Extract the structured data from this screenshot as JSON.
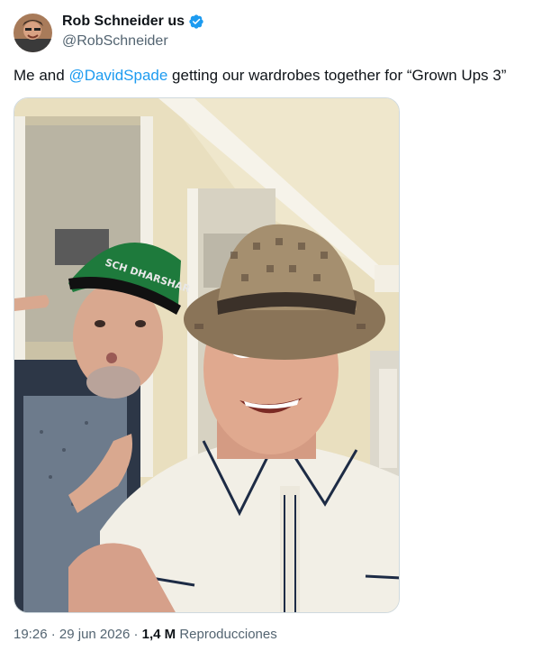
{
  "author": {
    "display_name": "Rob Schneider us",
    "handle": "@RobSchneider",
    "avatar_icon": "profile-photo",
    "verified_icon": "verified-badge-icon",
    "verified_color": "#1d9bf0"
  },
  "tweet": {
    "text_prefix": "Me and ",
    "mention": "@DavidSpade",
    "text_suffix": " getting our wardrobes together for “Grown Ups 3”",
    "mention_color": "#1d9bf0"
  },
  "media": {
    "hat_text": "SCH DHARSHAR"
  },
  "meta": {
    "time": "19:26",
    "separator": " · ",
    "date": "29 jun 2026",
    "separator2": " · ",
    "views_count": "1,4 M",
    "views_label": " Reproducciones"
  }
}
